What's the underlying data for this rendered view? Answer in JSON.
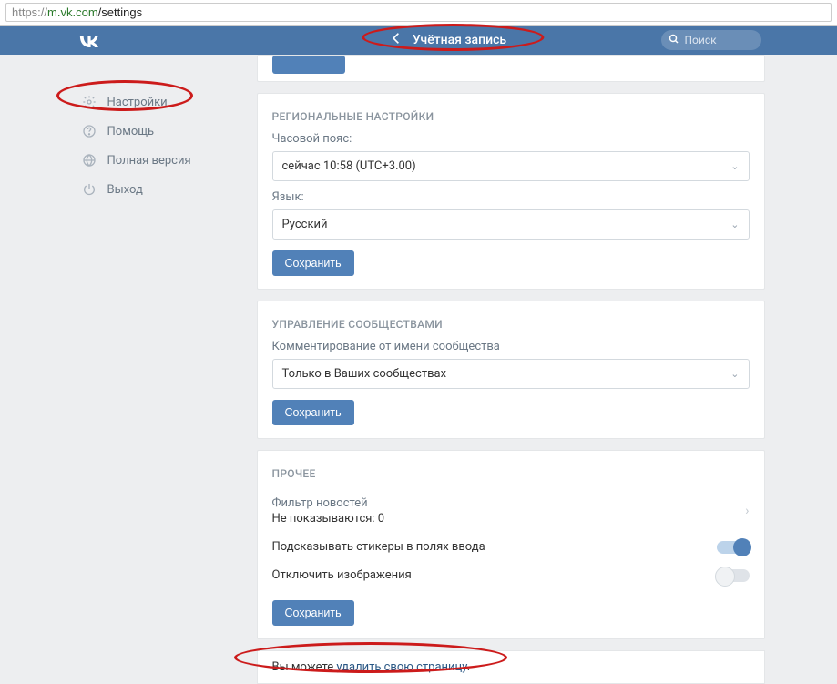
{
  "url": {
    "proto": "https://",
    "host": "m.vk.com",
    "path": "/settings"
  },
  "header": {
    "title": "Учётная запись",
    "search_placeholder": "Поиск"
  },
  "sidebar": {
    "items": [
      {
        "label": "Настройки"
      },
      {
        "label": "Помощь"
      },
      {
        "label": "Полная версия"
      },
      {
        "label": "Выход"
      }
    ]
  },
  "regional": {
    "title": "РЕГИОНАЛЬНЫЕ НАСТРОЙКИ",
    "tz_label": "Часовой пояс:",
    "tz_value": "сейчас 10:58 (UTC+3.00)",
    "lang_label": "Язык:",
    "lang_value": "Русский",
    "save": "Сохранить"
  },
  "communities": {
    "title": "УПРАВЛЕНИЕ СООБЩЕСТВАМИ",
    "comment_label": "Комментирование от имени сообщества",
    "comment_value": "Только в Ваших сообществах",
    "save": "Сохранить"
  },
  "other": {
    "title": "ПРОЧЕЕ",
    "news_filter_label": "Фильтр новостей",
    "news_filter_value": "Не показываются: 0",
    "stickers_label": "Подсказывать стикеры в полях ввода",
    "images_label": "Отключить изображения",
    "save": "Сохранить"
  },
  "footer": {
    "prefix": "Вы можете ",
    "link": "удалить свою страницу",
    "suffix": "."
  }
}
